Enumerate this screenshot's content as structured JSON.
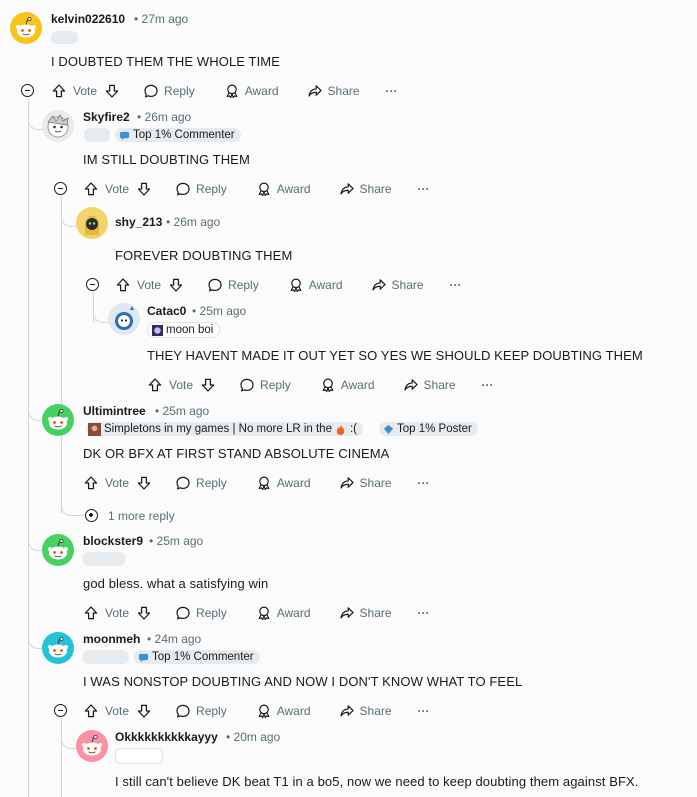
{
  "actions": {
    "vote": "Vote",
    "reply": "Reply",
    "award": "Award",
    "share": "Share",
    "more": "···"
  },
  "comments": [
    {
      "username": "kelvin022610",
      "time": "• 27m ago",
      "text": "I DOUBTED THEM THE WHOLE TIME",
      "avatar_color": "#f5c518"
    },
    {
      "username": "Skyfire2",
      "time": "• 26m ago",
      "flair": "Top 1% Commenter",
      "text": "IM STILL DOUBTING THEM"
    },
    {
      "username": "shy_213",
      "time": "• 26m ago",
      "text": "FOREVER DOUBTING THEM"
    },
    {
      "username": "Catac0",
      "time": "• 25m ago",
      "flair": "moon boi",
      "text": "THEY HAVENT MADE IT OUT YET SO YES WE SHOULD KEEP DOUBTING THEM"
    },
    {
      "username": "Ultimintree",
      "time": "• 25m ago",
      "flair": "Simpletons in my games | No more LR in the",
      "flair_suffix": ":(",
      "flair2": "Top 1% Poster",
      "text": "DK OR BFX AT FIRST STAND ABSOLUTE CINEMA",
      "more_replies": "1 more reply",
      "avatar_color": "#46d160"
    },
    {
      "username": "blockster9",
      "time": "• 25m ago",
      "text": "god bless. what a satisfying win",
      "avatar_color": "#46d160"
    },
    {
      "username": "moonmeh",
      "time": "• 24m ago",
      "flair": "Top 1% Commenter",
      "text": "I WAS NONSTOP DOUBTING AND NOW I DON'T KNOW WHAT TO FEEL",
      "avatar_color": "#24c2d6"
    },
    {
      "username": "Okkkkkkkkkkayyy",
      "time": "• 20m ago",
      "text": "I still can't believe DK beat T1 in a bo5, now we need to keep doubting them against BFX.",
      "avatar_color": "#ff8fa3"
    }
  ],
  "colors": {
    "meta": "#576f76",
    "line": "#d4d6d8",
    "flair_bg": "#e5ebee",
    "background": "#fbfbfb"
  }
}
